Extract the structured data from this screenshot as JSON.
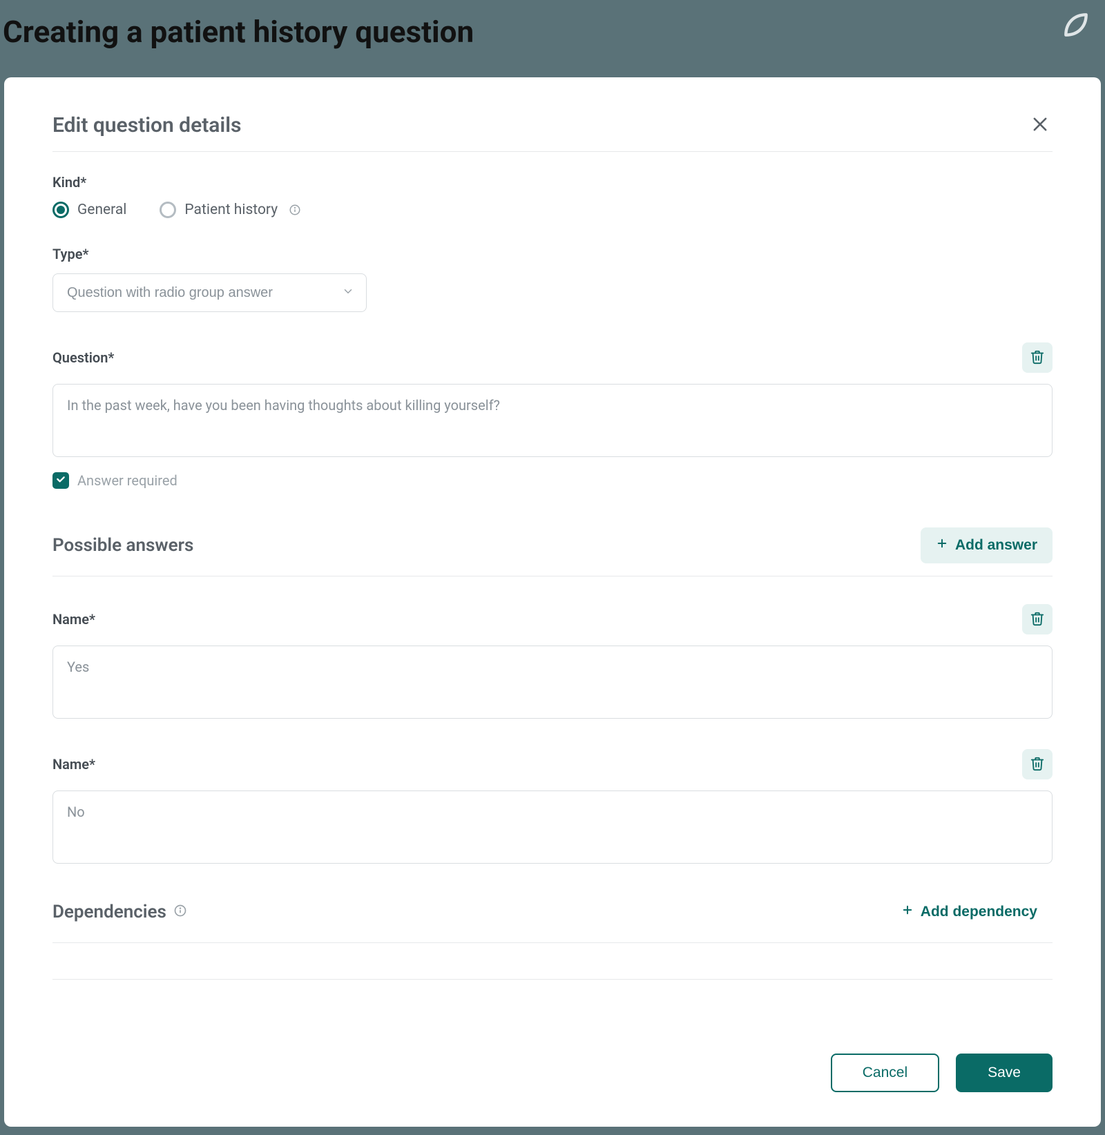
{
  "page": {
    "title": "Creating a patient history question"
  },
  "modal": {
    "title": "Edit question details"
  },
  "kind": {
    "label": "Kind*",
    "options": {
      "general": "General",
      "patient_history": "Patient history"
    },
    "selected": "general"
  },
  "type": {
    "label": "Type*",
    "value": "Question with radio group answer"
  },
  "question": {
    "label": "Question*",
    "value": "In the past week, have you been having thoughts about killing yourself?",
    "answer_required_label": "Answer required",
    "answer_required": true
  },
  "possible_answers": {
    "title": "Possible answers",
    "add_label": "Add answer",
    "name_label": "Name*",
    "items": [
      {
        "value": "Yes"
      },
      {
        "value": "No"
      }
    ]
  },
  "dependencies": {
    "title": "Dependencies",
    "add_label": "Add dependency"
  },
  "footer": {
    "cancel": "Cancel",
    "save": "Save"
  }
}
